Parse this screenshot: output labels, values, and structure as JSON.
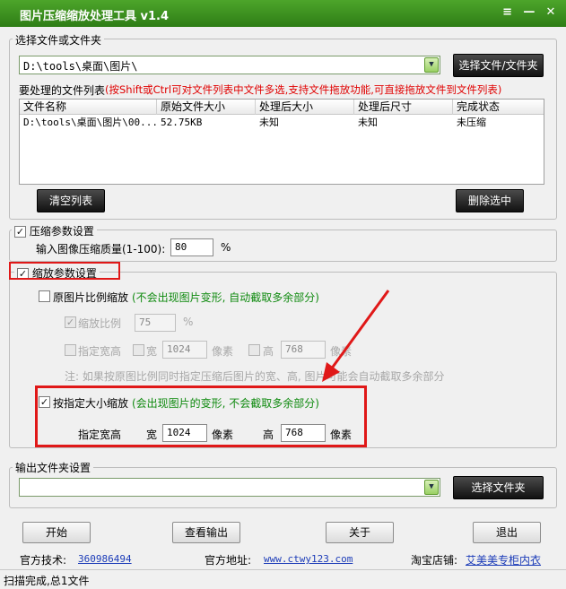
{
  "window": {
    "title": "图片压缩缩放处理工具 v1.4",
    "menu_glyph": "≡",
    "min_glyph": "—",
    "close_glyph": "✕"
  },
  "source": {
    "legend": "选择文件或文件夹",
    "path": "D:\\tools\\桌面\\图片\\",
    "choose_button": "选择文件/文件夹",
    "list_label": "要处理的文件列表",
    "list_hint": "(按Shift或Ctrl可对文件列表中文件多选,支持文件拖放功能,可直接拖放文件到文件列表)",
    "columns": [
      "文件名称",
      "原始文件大小",
      "处理后大小",
      "处理后尺寸",
      "完成状态"
    ],
    "rows": [
      [
        "D:\\tools\\桌面\\图片\\00...",
        "52.75KB",
        "未知",
        "未知",
        "未压缩"
      ]
    ],
    "clear_button": "清空列表",
    "delete_button": "删除选中"
  },
  "compress": {
    "legend": "压缩参数设置",
    "checked": true,
    "quality_label": "输入图像压缩质量(1-100):",
    "quality_value": "80",
    "unit": "%"
  },
  "scale": {
    "legend": "缩放参数设置",
    "checked": true,
    "ratio_mode_label": "原图片比例缩放",
    "ratio_mode_hint": "(不会出现图片变形, 自动截取多余部分)",
    "ratio_label": "缩放比例",
    "ratio_value": "75",
    "ratio_unit": "%",
    "fixed_label": "指定宽高",
    "width_label": "宽",
    "width_value": "1024",
    "width_unit": "像素",
    "height_label": "高",
    "height_value": "768",
    "height_unit": "像素",
    "note": "注: 如果按原图比例同时指定压缩后图片的宽、高, 图片可能会自动截取多余部分",
    "size_mode_label": "按指定大小缩放",
    "size_mode_hint": "(会出现图片的变形, 不会截取多余部分)",
    "size_fixed_label": "指定宽高",
    "size_width_label": "宽",
    "size_width_value": "1024",
    "size_width_unit": "像素",
    "size_height_label": "高",
    "size_height_value": "768",
    "size_height_unit": "像素"
  },
  "output": {
    "legend": "输出文件夹设置",
    "path": "",
    "choose_button": "选择文件夹"
  },
  "actions": {
    "start": "开始",
    "view_output": "查看输出",
    "about": "关于",
    "exit": "退出"
  },
  "footer": {
    "support_label": "官方技术:",
    "support_value": "360986494",
    "site_label": "官方地址:",
    "site_value": "www.ctwy123.com",
    "shop_label": "淘宝店铺:",
    "shop_value": "艾美美专柜内衣"
  },
  "status": "扫描完成,总1文件",
  "colors": {
    "title_bar": "#2e7d16",
    "hint_red": "#e00000",
    "hint_green": "#0f8a0f",
    "annotation_red": "#e01818"
  }
}
